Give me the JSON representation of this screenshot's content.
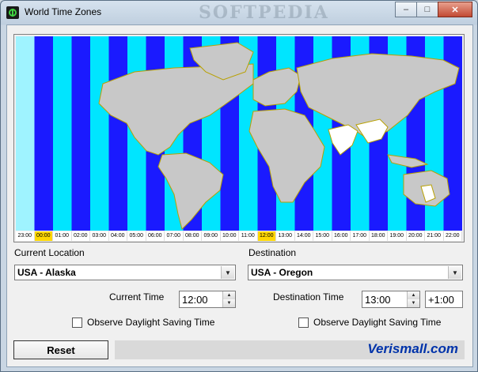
{
  "window": {
    "title": "World Time Zones",
    "watermark": "SOFTPEDIA"
  },
  "titlebar_buttons": {
    "minimize": "–",
    "maximize": "□",
    "close": "✕"
  },
  "map": {
    "colors": {
      "zone_a": "#1a1aff",
      "zone_b": "#00e5ff",
      "land": "#c8c8c8",
      "highlight_zone": "#9ff3ff",
      "tick_highlight": "#ffd700"
    },
    "hours": [
      "23:00",
      "00:00",
      "01:00",
      "02:00",
      "03:00",
      "04:00",
      "05:00",
      "06:00",
      "07:00",
      "08:00",
      "09:00",
      "10:00",
      "11:00",
      "12:00",
      "13:00",
      "14:00",
      "15:00",
      "16:00",
      "17:00",
      "18:00",
      "19:00",
      "20:00",
      "21:00",
      "22:00"
    ],
    "highlighted_hours": [
      "00:00",
      "12:00"
    ]
  },
  "current": {
    "label": "Current Location",
    "location": "USA - Alaska",
    "time_label": "Current Time",
    "time": "12:00",
    "dst_label": "Observe Daylight Saving Time",
    "dst_checked": false
  },
  "destination": {
    "label": "Destination",
    "location": "USA - Oregon",
    "time_label": "Destination Time",
    "time": "13:00",
    "offset": "+1:00",
    "dst_label": "Observe Daylight Saving Time",
    "dst_checked": false
  },
  "reset_label": "Reset",
  "brand": "Verismall.com"
}
